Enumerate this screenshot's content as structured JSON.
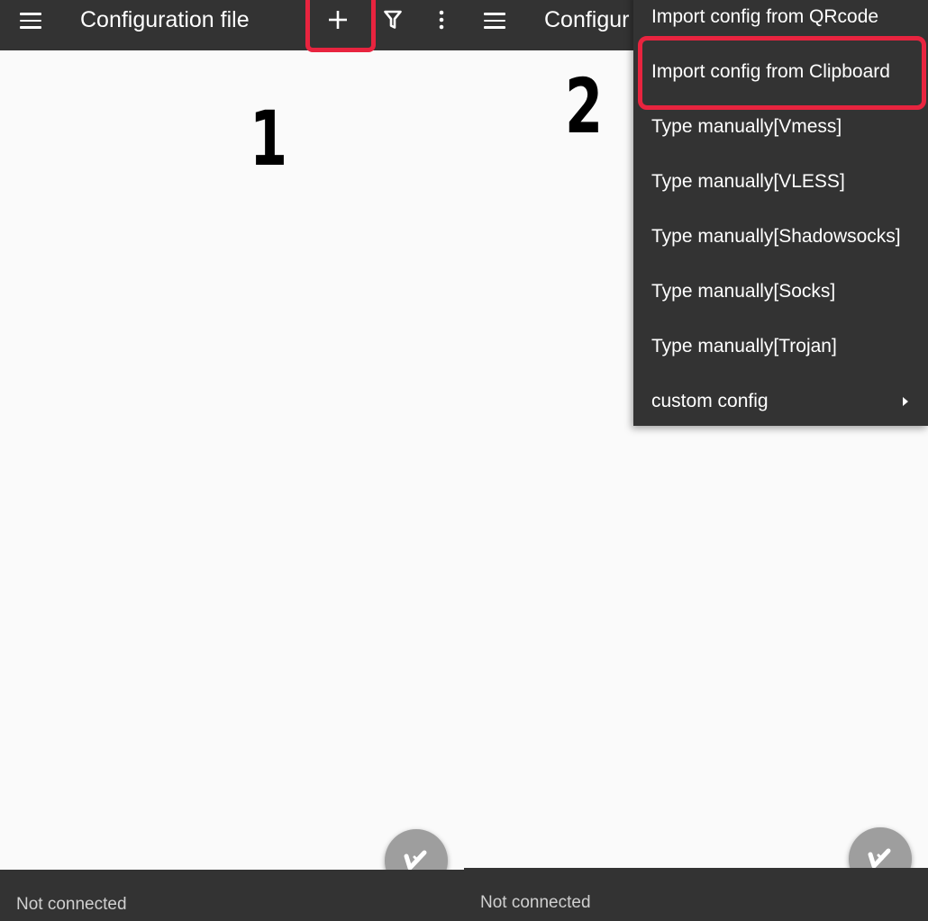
{
  "panel_1": {
    "toolbar": {
      "title": "Configuration file",
      "menu_icon": "hamburger-menu-icon",
      "add_icon": "plus-icon",
      "filter_icon": "filter-icon",
      "more_icon": "more-vert-icon"
    },
    "step_label": "1",
    "fab_icon": "v-logo-icon",
    "status": "Not connected"
  },
  "panel_2": {
    "toolbar": {
      "title": "Configur",
      "menu_icon": "hamburger-menu-icon"
    },
    "step_label": "2",
    "popup_menu": {
      "items": [
        "Import config from QRcode",
        "Import config from Clipboard",
        "Type manually[Vmess]",
        "Type manually[VLESS]",
        "Type manually[Shadowsocks]",
        "Type manually[Socks]",
        "Type manually[Trojan]",
        "custom config"
      ],
      "submenu_icon": "chevron-right-icon"
    },
    "fab_icon": "v-logo-icon",
    "status": "Not connected"
  },
  "colors": {
    "toolbar_bg": "#333333",
    "content_bg": "#fafafa",
    "highlight": "#e8243f",
    "fab": "#9e9e9e",
    "status_text": "#d0d0d0"
  }
}
